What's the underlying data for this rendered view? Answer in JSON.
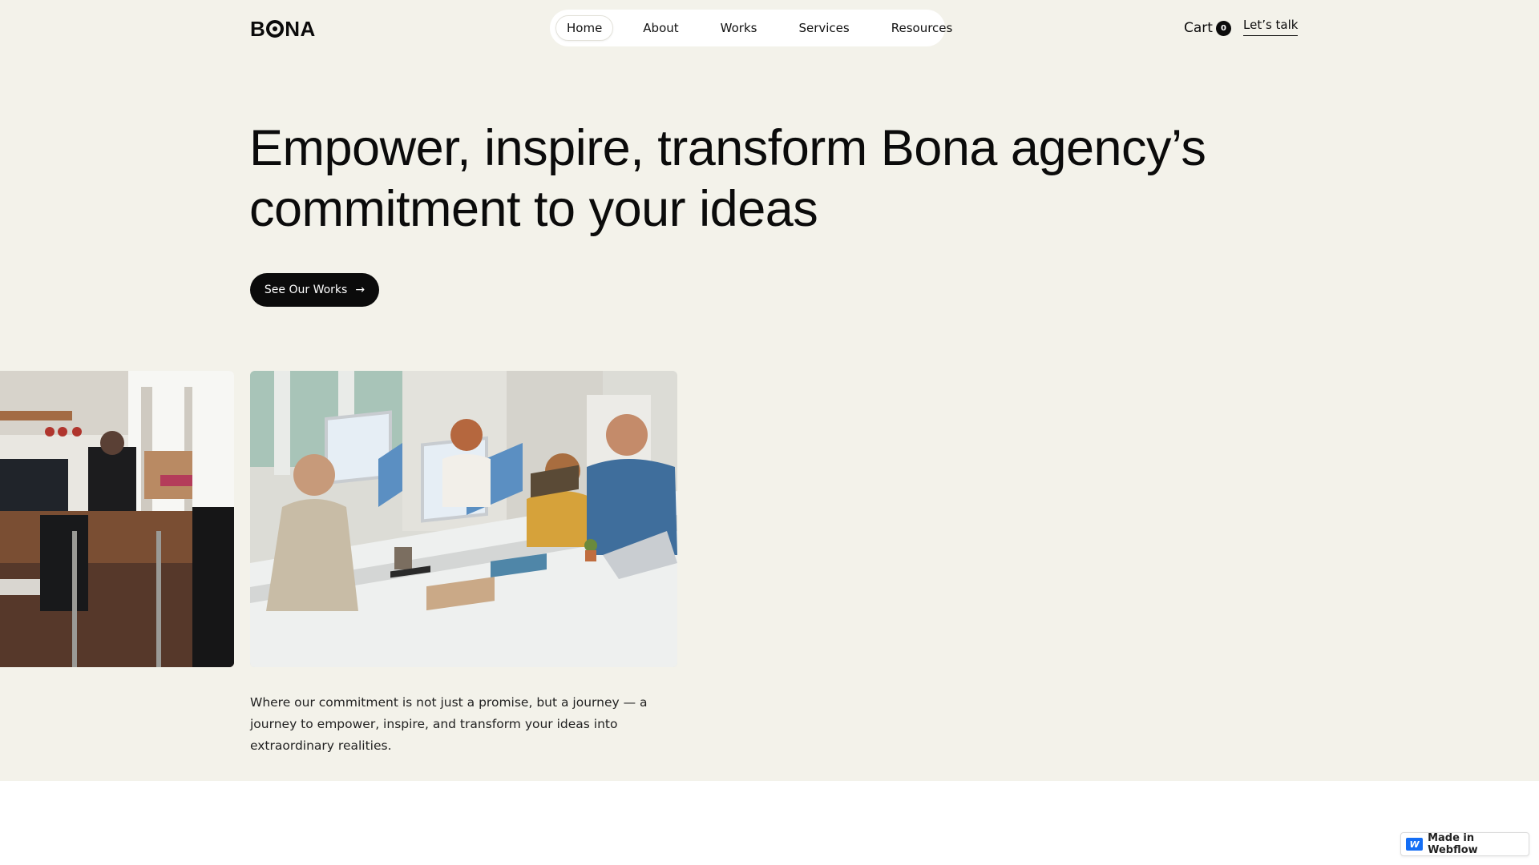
{
  "brand": {
    "logo_left": "B",
    "logo_right": "NA"
  },
  "nav": {
    "items": [
      {
        "label": "Home"
      },
      {
        "label": "About"
      },
      {
        "label": "Works"
      },
      {
        "label": "Services"
      },
      {
        "label": "Resources"
      }
    ],
    "active": "Home"
  },
  "header": {
    "cart_label": "Cart",
    "cart_count": "0",
    "talk_label": "Let’s talk"
  },
  "hero": {
    "headline": "Empower, inspire, transform Bona agency’s commitment to your ideas",
    "cta_label": "See Our Works",
    "cta_icon": "arrow-right-icon",
    "caption": "Where our commitment is not just a promise, but a journey — a journey to empower, inspire, and transform your ideas into extraordinary realities."
  },
  "images": [
    {
      "name": "office-photo-left"
    },
    {
      "name": "office-photo-team"
    }
  ],
  "badge": {
    "label": "Made in Webflow",
    "icon": "webflow-icon"
  },
  "colors": {
    "hero_background": "#f3f2ea",
    "page_background": "#ffffff",
    "primary": "#0b0b0b",
    "button_text": "#ffffff",
    "webflow_blue": "#146ef5"
  }
}
